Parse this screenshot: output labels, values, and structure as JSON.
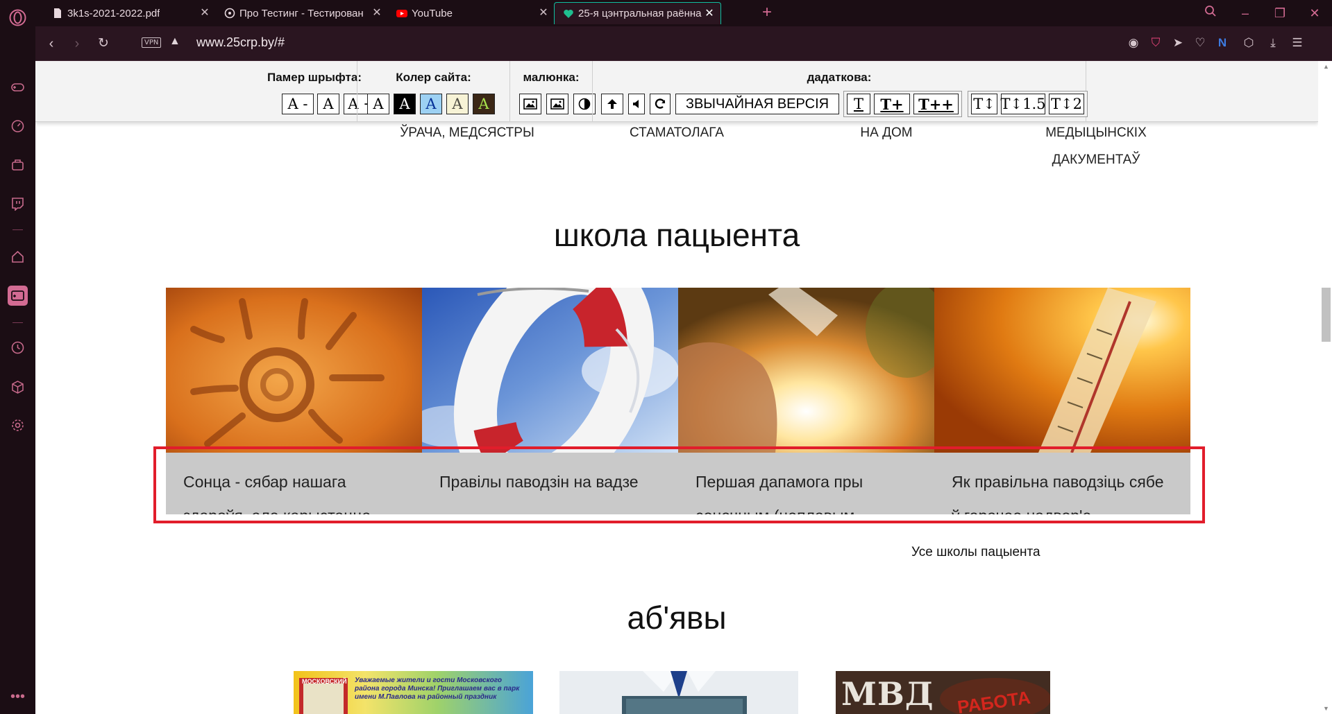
{
  "browser": {
    "tabs": [
      {
        "title": "3k1s-2021-2022.pdf",
        "icon": "document-icon",
        "active": false
      },
      {
        "title": "Про Тестинг - Тестирован",
        "icon": "protesting-icon",
        "active": false
      },
      {
        "title": "YouTube",
        "icon": "youtube-icon",
        "active": false
      },
      {
        "title": "25-я цэнтральная раённа",
        "icon": "heart-site-icon",
        "active": true
      }
    ],
    "url": "www.25crp.by/#",
    "vpn_label": "VPN"
  },
  "accessibility_panel": {
    "font_size": {
      "label": "Памер шрыфта:",
      "buttons": [
        "A -",
        "A",
        "A +"
      ]
    },
    "site_color": {
      "label": "Колер сайта:",
      "buttons": [
        "A",
        "A",
        "A",
        "A",
        "A"
      ]
    },
    "images": {
      "label": "малюнка:"
    },
    "extra": {
      "label": "дадаткова:",
      "normal_version": "ЗВЫЧАЙНАЯ ВЕРСІЯ",
      "letter_spacing": [
        "T",
        "T+",
        "T++"
      ],
      "line_height": [
        "T↕",
        "T↕1.5",
        "T↕2"
      ]
    }
  },
  "services": [
    {
      "lines": [
        "ЎРАЧА, МЕДСЯСТРЫ"
      ]
    },
    {
      "lines": [
        "СТАМАТОЛАГА"
      ]
    },
    {
      "lines": [
        "НА ДОМ"
      ]
    },
    {
      "lines": [
        "МЕДЫЦЫНСКІХ",
        "ДАКУМЕНТАЎ"
      ]
    }
  ],
  "patient_school": {
    "title": "школа пацыента",
    "cards": [
      {
        "caption": "Сонца - сябар нашага здароўя, але карыстацца",
        "image": "sun-in-sand"
      },
      {
        "caption": "Правілы паводзін на вадзе",
        "image": "lifebuoy"
      },
      {
        "caption": "Першая дапамога пры сонечным (цеплавым",
        "image": "sunstroke"
      },
      {
        "caption": "Як правільна паводзіць сябе ў гарачае надвор'е",
        "image": "thermometer"
      }
    ],
    "all_link": "Усе школы пацыента"
  },
  "ads": {
    "title": "аб'явы",
    "cards": [
      {
        "text": "МОСКОВСКИЙ",
        "subtext": "Уважаемые жители и гости Московского района города Минска! Приглашаем вас в парк имени М.Павлова на районный праздник"
      },
      {
        "text": ""
      },
      {
        "text": "МВД",
        "subtext": "РАБОТА"
      }
    ]
  },
  "colors": {
    "browser_bg": "#1b0d14",
    "accent": "#d36b93",
    "active_tab_border": "#0fbfa0",
    "caption_bg": "#c9c9c9",
    "highlight": "#e11d2b"
  }
}
